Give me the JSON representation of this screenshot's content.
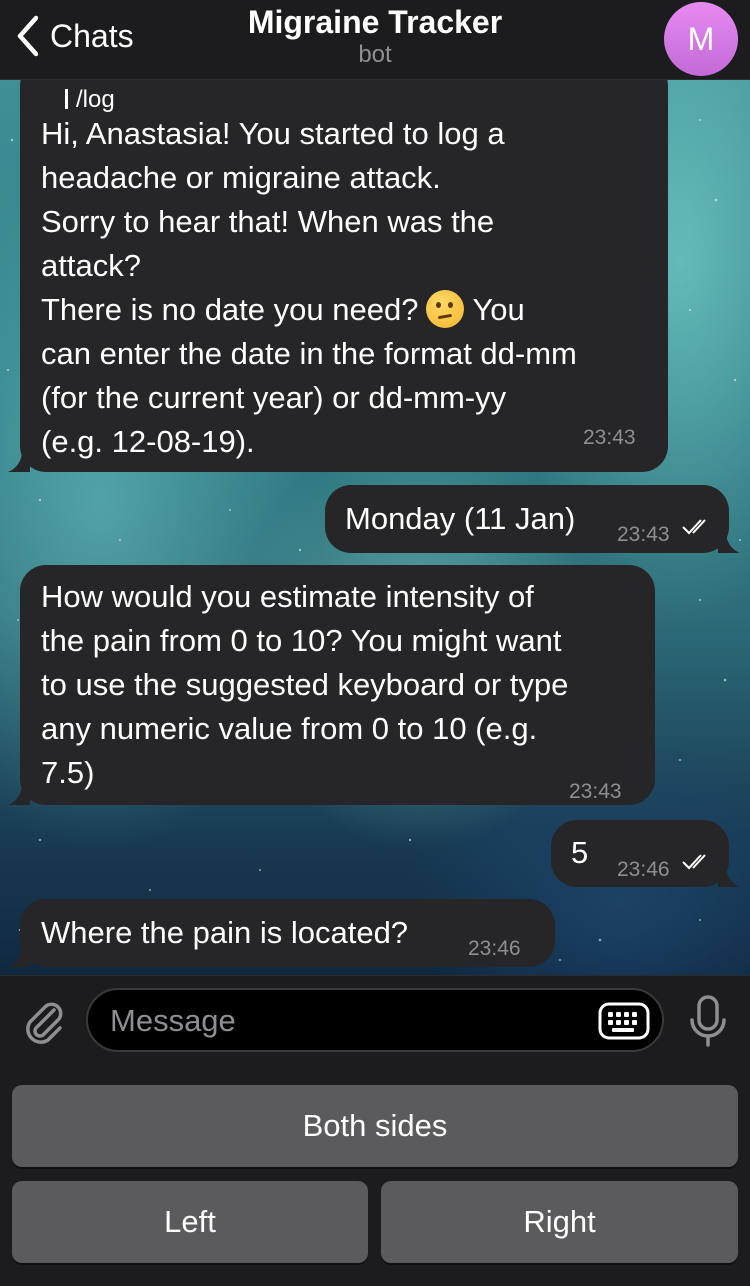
{
  "header": {
    "back_label": "Chats",
    "title": "Migraine Tracker",
    "subtitle": "bot",
    "avatar_letter": "M"
  },
  "messages": [
    {
      "direction": "incoming",
      "reply_text": "/log",
      "lines": [
        "Hi, Anastasia! You started to log a",
        "headache or migraine attack.",
        "Sorry to hear that! When was the",
        "attack?",
        "There is no date you need?",
        "You",
        "can enter the date in the format dd-mm",
        "(for the current year) or dd-mm-yy",
        "(e.g. 12-08-19)."
      ],
      "emoji": "thinking-face",
      "time": "23:43"
    },
    {
      "direction": "outgoing",
      "text": "Monday (11 Jan)",
      "time": "23:43",
      "status": "read"
    },
    {
      "direction": "incoming",
      "lines": [
        "How would you estimate intensity of",
        "the pain from 0 to 10? You might want",
        "to use the suggested keyboard or type",
        "any numeric value from 0 to 10 (e.g.",
        "7.5)"
      ],
      "time": "23:43"
    },
    {
      "direction": "outgoing",
      "text": "5",
      "time": "23:46",
      "status": "read"
    },
    {
      "direction": "incoming",
      "text": "Where the pain is located?",
      "time": "23:46"
    }
  ],
  "composer": {
    "placeholder": "Message",
    "value": ""
  },
  "keyboard": {
    "rows": [
      [
        "Both sides"
      ],
      [
        "Left",
        "Right"
      ]
    ]
  },
  "colors": {
    "accent": "#c46ad8",
    "bubble": "#262628",
    "bar": "#1c1c1e",
    "key": "#5b5b5e"
  }
}
